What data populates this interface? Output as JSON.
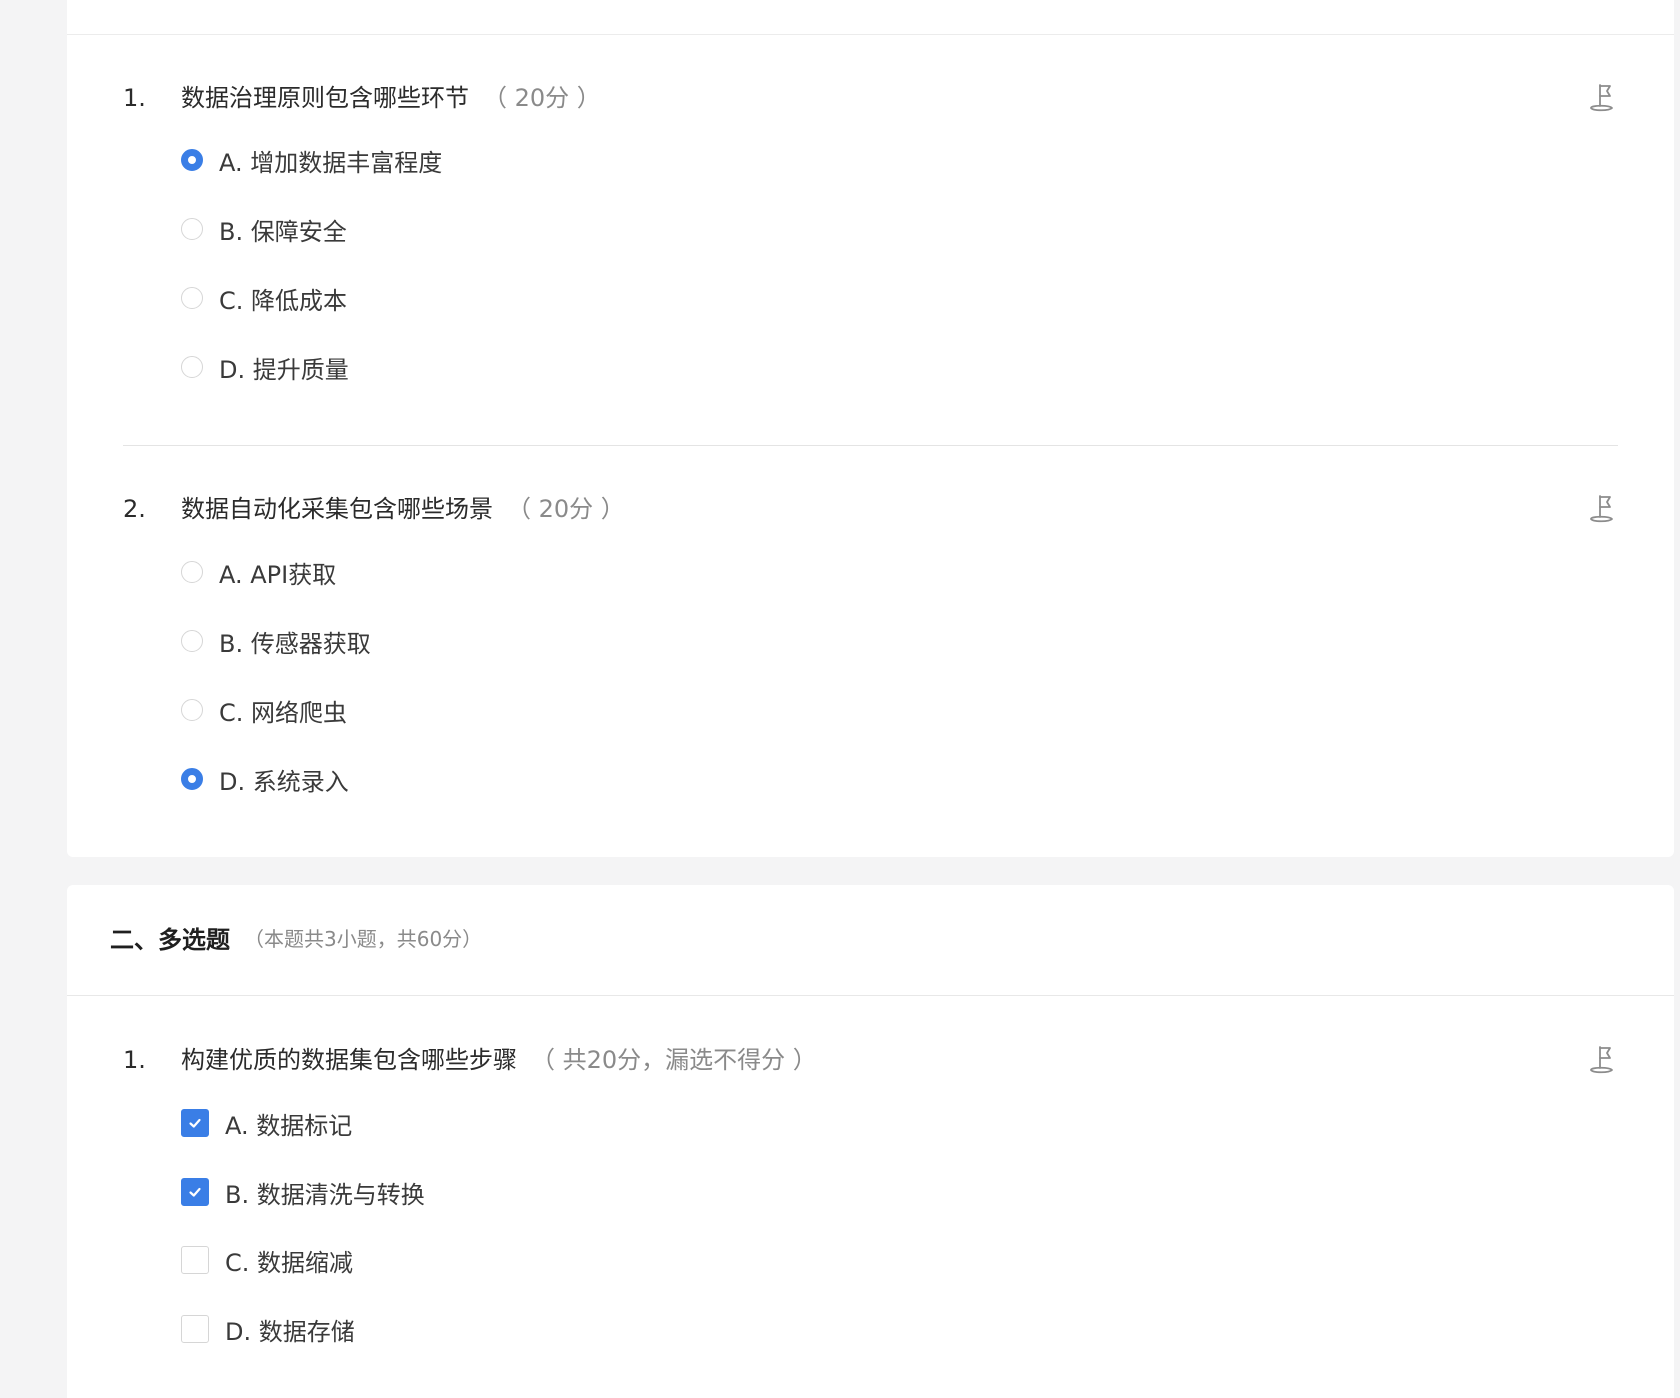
{
  "single_choice": {
    "questions": [
      {
        "number": "1.",
        "title": "数据治理原则包含哪些环节",
        "score": "（ 20分 ）",
        "options": [
          {
            "label": "A. 增加数据丰富程度",
            "checked": true
          },
          {
            "label": "B. 保障安全",
            "checked": false
          },
          {
            "label": "C. 降低成本",
            "checked": false
          },
          {
            "label": "D. 提升质量",
            "checked": false
          }
        ]
      },
      {
        "number": "2.",
        "title": "数据自动化采集包含哪些场景",
        "score": "（ 20分 ）",
        "options": [
          {
            "label": "A. API获取",
            "checked": false
          },
          {
            "label": "B. 传感器获取",
            "checked": false
          },
          {
            "label": "C. 网络爬虫",
            "checked": false
          },
          {
            "label": "D. 系统录入",
            "checked": true
          }
        ]
      }
    ]
  },
  "multiple_choice": {
    "title": "二、多选题",
    "meta": "（本题共3小题，共60分）",
    "questions": [
      {
        "number": "1.",
        "title": "构建优质的数据集包含哪些步骤",
        "score": "（ 共20分，漏选不得分 ）",
        "options": [
          {
            "label": "A. 数据标记",
            "checked": true
          },
          {
            "label": "B. 数据清洗与转换",
            "checked": true
          },
          {
            "label": "C. 数据缩减",
            "checked": false
          },
          {
            "label": "D. 数据存储",
            "checked": false
          }
        ]
      }
    ]
  },
  "colors": {
    "accent": "#3a7ee6",
    "background": "#f4f4f5",
    "card": "#ffffff"
  },
  "icons": {
    "flag": "flag-icon",
    "check": "check-icon"
  }
}
